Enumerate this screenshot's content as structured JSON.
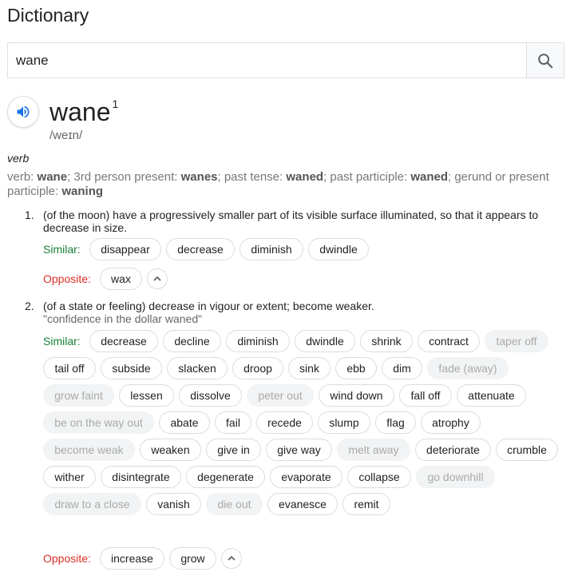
{
  "title": "Dictionary",
  "search": {
    "value": "wane",
    "icon": "search-icon"
  },
  "entry": {
    "word": "wane",
    "superscript": "1",
    "phonetic": "/weɪn/",
    "part_of_speech": "verb",
    "forms": {
      "prefix": "verb:",
      "base": "wane",
      "label_3rd": "; 3rd person present:",
      "third_person": "wanes",
      "label_past": "; past tense:",
      "past": "waned",
      "label_pp": "; past participle:",
      "past_participle": "waned",
      "label_ger": "; gerund or present participle:",
      "gerund": "waning"
    }
  },
  "labels": {
    "similar": "Similar:",
    "opposite": "Opposite:"
  },
  "senses": [
    {
      "number": "1.",
      "definition": "(of the moon) have a progressively smaller part of its visible surface illuminated, so that it appears to decrease in size.",
      "similar": [
        "disappear",
        "decrease",
        "diminish",
        "dwindle"
      ],
      "opposite": [
        "wax"
      ]
    },
    {
      "number": "2.",
      "definition": "(of a state or feeling) decrease in vigour or extent; become weaker.",
      "example": "\"confidence in the dollar waned\"",
      "similar": [
        "decrease",
        "decline",
        "diminish",
        "dwindle",
        "shrink",
        "contract",
        "taper off",
        "tail off",
        "subside",
        "slacken",
        "droop",
        "sink",
        "ebb",
        "dim",
        "fade (away)",
        "grow faint",
        "lessen",
        "dissolve",
        "peter out",
        "wind down",
        "fall off",
        "attenuate",
        "be on the way out",
        "abate",
        "fail",
        "recede",
        "slump",
        "flag",
        "atrophy",
        "become weak",
        "weaken",
        "give in",
        "give way",
        "melt away",
        "deteriorate",
        "crumble",
        "wither",
        "disintegrate",
        "degenerate",
        "evaporate",
        "collapse",
        "go downhill",
        "draw to a close",
        "vanish",
        "die out",
        "evanesce",
        "remit"
      ],
      "muted": [
        "taper off",
        "fade (away)",
        "grow faint",
        "peter out",
        "be on the way out",
        "become weak",
        "melt away",
        "go downhill",
        "draw to a close",
        "die out"
      ],
      "opposite": [
        "increase",
        "grow"
      ]
    }
  ]
}
